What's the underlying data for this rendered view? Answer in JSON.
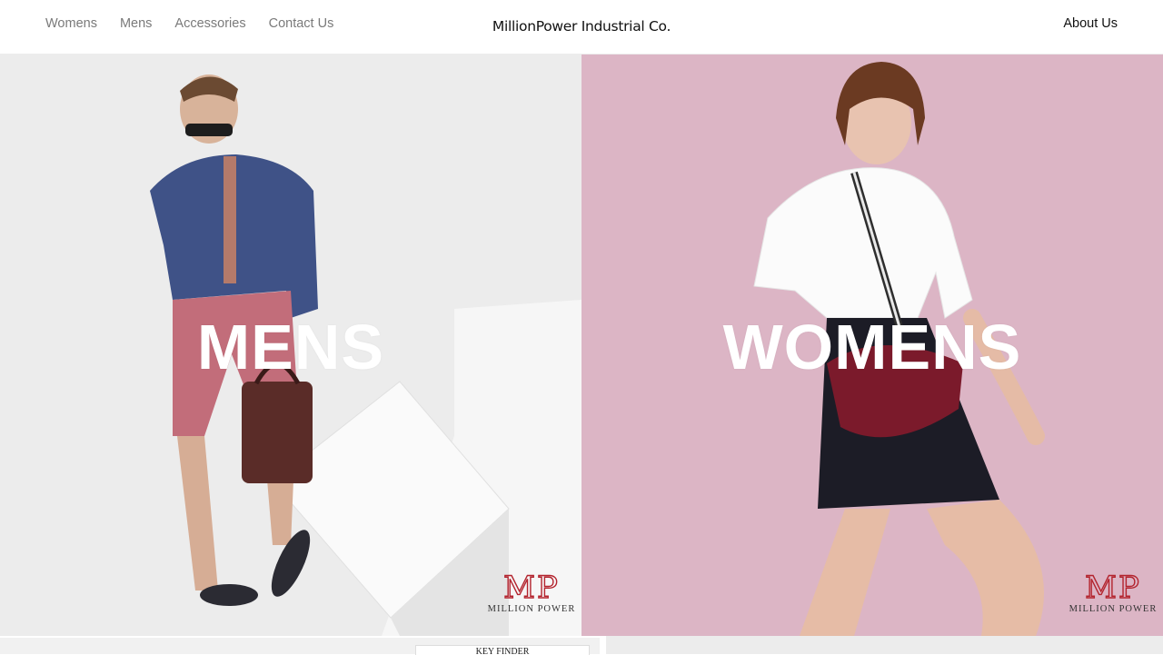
{
  "header": {
    "nav": [
      "Womens",
      "Mens",
      "Accessories",
      "Contact Us"
    ],
    "brand": "MillionPower Industrial Co.",
    "about": "About Us"
  },
  "panels": {
    "men": {
      "title": "MENS"
    },
    "women": {
      "title": "WOMENS"
    }
  },
  "logo": {
    "mark": "MP",
    "text": "MILLION POWER"
  },
  "bottom": {
    "key_finder": "KEY FINDER"
  },
  "colors": {
    "women_bg": "#dcb4c4",
    "men_bg": "#ebebeb",
    "logo_red": "#b3242e"
  }
}
